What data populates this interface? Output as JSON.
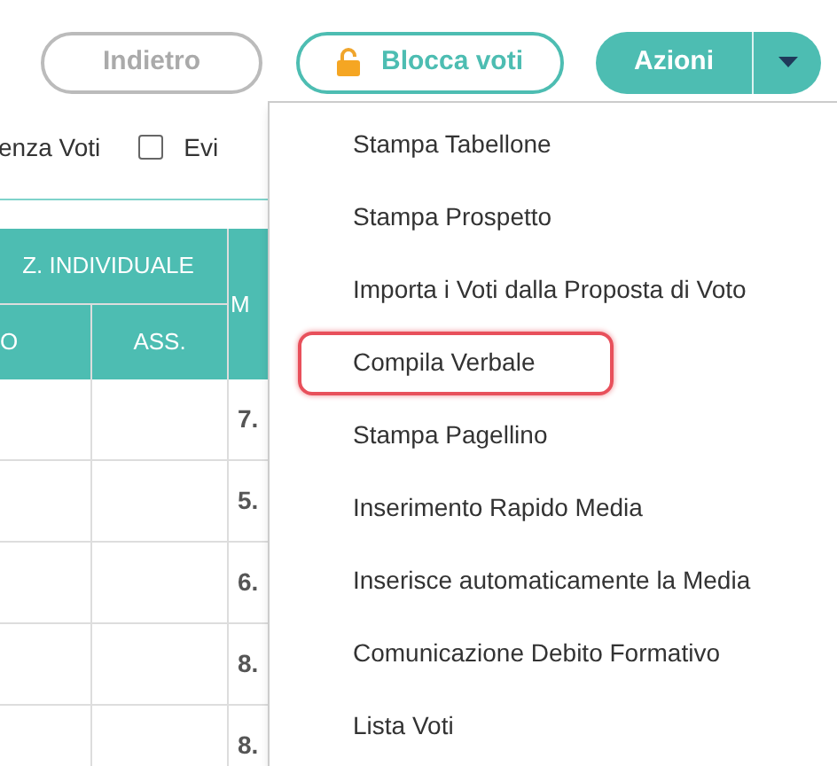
{
  "buttons": [
    {
      "kind": "outline-grey",
      "label": "Indietro"
    },
    {
      "kind": "outline-teal",
      "label": "Blocca voti"
    },
    {
      "kind": "split-teal",
      "label": "Azioni"
    }
  ],
  "options": [
    {
      "kind": "text",
      "label": "enza Voti"
    },
    {
      "kind": "checkbox",
      "label": "Evi",
      "checked": false
    }
  ],
  "table": {
    "group_header": "Z. INDIVIDUALE",
    "columns": [
      "O",
      "ASS."
    ],
    "column_3": "M",
    "rows": [
      {
        "column_3": "7."
      },
      {
        "column_3": "5."
      },
      {
        "column_3": "6."
      },
      {
        "column_3": "8."
      },
      {
        "column_3": "8."
      }
    ]
  },
  "menu": {
    "expanded": true,
    "items": [
      {
        "label": "Stampa Tabellone",
        "highlighted": false
      },
      {
        "label": "Stampa Prospetto",
        "highlighted": false
      },
      {
        "label": "Importa i Voti dalla Proposta di Voto",
        "highlighted": false
      },
      {
        "label": "Compila Verbale",
        "highlighted": true
      },
      {
        "label": "Stampa Pagellino",
        "highlighted": false
      },
      {
        "label": "Inserimento Rapido Media",
        "highlighted": false
      },
      {
        "label": "Inserisce automaticamente la Media",
        "highlighted": false
      },
      {
        "label": "Comunicazione Debito Formativo",
        "highlighted": false
      },
      {
        "label": "Lista Voti",
        "highlighted": false
      }
    ]
  }
}
